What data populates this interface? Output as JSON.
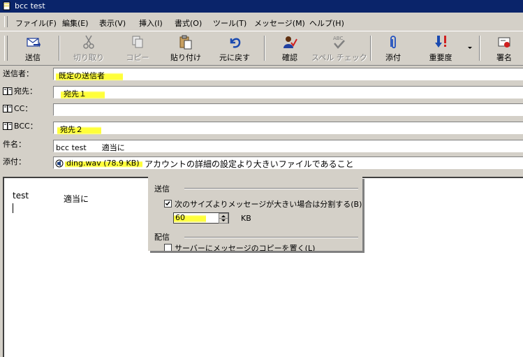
{
  "window": {
    "title": "bcc test"
  },
  "menu": [
    {
      "label": "ファイル(F)"
    },
    {
      "label": "編集(E)"
    },
    {
      "label": "表示(V)"
    },
    {
      "label": "挿入(I)"
    },
    {
      "label": "書式(O)"
    },
    {
      "label": "ツール(T)"
    },
    {
      "label": "メッセージ(M)"
    },
    {
      "label": "ヘルプ(H)"
    }
  ],
  "toolbar": {
    "send": "送信",
    "cut": "切り取り",
    "copy": "コピー",
    "paste": "貼り付け",
    "undo": "元に戻す",
    "check": "確認",
    "spell": "スペル チェック",
    "attach": "添付",
    "priority": "重要度",
    "sign": "署名"
  },
  "header": {
    "from_label": "送信者：",
    "from_value": "既定の送信者",
    "to_label": "宛先：",
    "to_value": "宛先１",
    "cc_label": "CC：",
    "cc_value": "",
    "bcc_label": "BCC：",
    "bcc_value": "宛先２",
    "subject_label": "件名：",
    "subject_value": "bcc test　　適当に",
    "attach_label": "添付：",
    "attach_file": "ding.wav (78.9 KB)",
    "attach_note": "アカウントの詳細の設定より大きいファイルであること"
  },
  "body": {
    "line1_a": "test",
    "line1_b": "適当に"
  },
  "popup": {
    "section_send": "送信",
    "split_label": "次のサイズよりメッセージが大きい場合は分割する(B)",
    "split_checked": true,
    "size_value": "60",
    "size_unit": "KB",
    "section_deliver": "配信",
    "server_copy_label": "サーバーにメッセージのコピーを置く(L)"
  },
  "colors": {
    "titlebar": "#0a246a",
    "highlight": "#ffff3a",
    "face": "#d4d0c8"
  }
}
